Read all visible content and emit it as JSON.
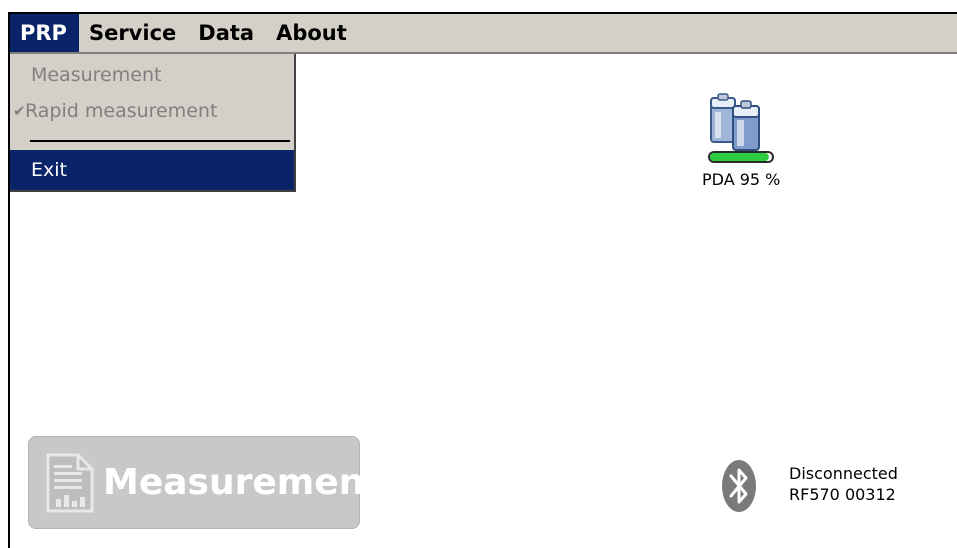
{
  "menubar": {
    "items": [
      {
        "label": "PRP",
        "active": true
      },
      {
        "label": "Service"
      },
      {
        "label": "Data"
      },
      {
        "label": "About"
      }
    ]
  },
  "dropdown": {
    "items": [
      {
        "label": "Measurement",
        "enabled": false
      },
      {
        "label": "Rapid measurement",
        "enabled": false,
        "checked": true
      },
      {
        "label": "Exit",
        "enabled": true,
        "selected": true
      }
    ]
  },
  "battery": {
    "label": "PDA 95 %",
    "level": 0.95,
    "icon": "battery-icon"
  },
  "main_button": {
    "label": "Measurement",
    "enabled": false,
    "icon": "document-chart-icon"
  },
  "bluetooth": {
    "status": "Disconnected",
    "device": "RF570 00312",
    "icon": "bluetooth-icon"
  },
  "colors": {
    "menu_bg": "#d4d0c8",
    "highlight": "#0a246a",
    "battery_fill": "#2ecc40",
    "button_bg": "#c8c8c8"
  }
}
